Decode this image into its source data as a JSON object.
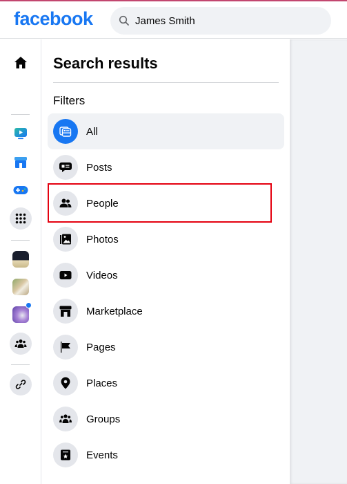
{
  "header": {
    "logo": "facebook",
    "search_value": "James Smith",
    "search_icon": "search-icon"
  },
  "left_rail": {
    "items": [
      {
        "name": "home",
        "icon": "home-icon"
      },
      {
        "name": "watch",
        "icon": "watch-icon"
      },
      {
        "name": "marketplace",
        "icon": "marketplace-icon"
      },
      {
        "name": "gaming",
        "icon": "gaming-icon"
      },
      {
        "name": "menu",
        "icon": "grid-menu-icon"
      },
      {
        "name": "shortcut-1",
        "icon": "shortcut-thumbnail"
      },
      {
        "name": "shortcut-2",
        "icon": "shortcut-thumbnail"
      },
      {
        "name": "shortcut-3",
        "icon": "shortcut-thumbnail",
        "notification": true
      },
      {
        "name": "groups",
        "icon": "groups-icon"
      },
      {
        "name": "link",
        "icon": "link-icon"
      }
    ]
  },
  "main": {
    "title": "Search results",
    "filters_label": "Filters",
    "filters": [
      {
        "label": "All",
        "icon": "all-icon",
        "active": true
      },
      {
        "label": "Posts",
        "icon": "posts-icon",
        "active": false
      },
      {
        "label": "People",
        "icon": "people-icon",
        "active": false,
        "highlighted": true
      },
      {
        "label": "Photos",
        "icon": "photos-icon",
        "active": false
      },
      {
        "label": "Videos",
        "icon": "videos-icon",
        "active": false
      },
      {
        "label": "Marketplace",
        "icon": "marketplace-icon",
        "active": false
      },
      {
        "label": "Pages",
        "icon": "pages-icon",
        "active": false
      },
      {
        "label": "Places",
        "icon": "places-icon",
        "active": false
      },
      {
        "label": "Groups",
        "icon": "groups-icon",
        "active": false
      },
      {
        "label": "Events",
        "icon": "events-icon",
        "active": false
      }
    ]
  },
  "colors": {
    "brand": "#1877f2",
    "highlight_box": "#e4000f",
    "notification_dot": "#1877f2"
  }
}
